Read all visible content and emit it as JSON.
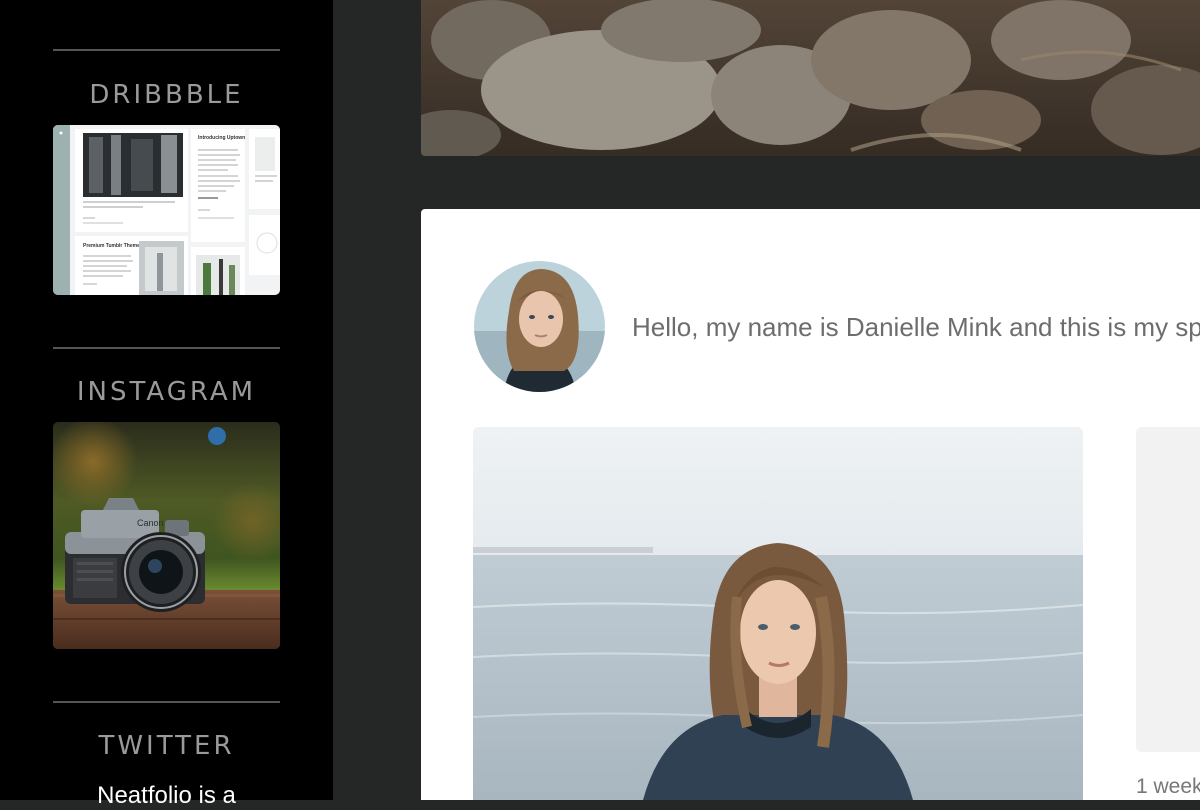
{
  "sidebar": {
    "sections": [
      {
        "heading": "DRIBBBLE"
      },
      {
        "heading": "INSTAGRAM"
      },
      {
        "heading": "TWITTER"
      }
    ],
    "dribbble_shot": {
      "posts": [
        {
          "title": "Introducing Uptown"
        },
        {
          "title": "Premium Tumblr Themes"
        }
      ]
    },
    "twitter_text": "Neatfolio is a"
  },
  "post": {
    "intro_text": "Hello, my name is Danielle Mink and this is my sp",
    "timestamp": "1 week"
  },
  "colors": {
    "sidebar_bg": "#000000",
    "main_bg": "#252726",
    "card_bg": "#ffffff",
    "heading": "#9a9a9a",
    "body_text": "#6d6d6d"
  }
}
